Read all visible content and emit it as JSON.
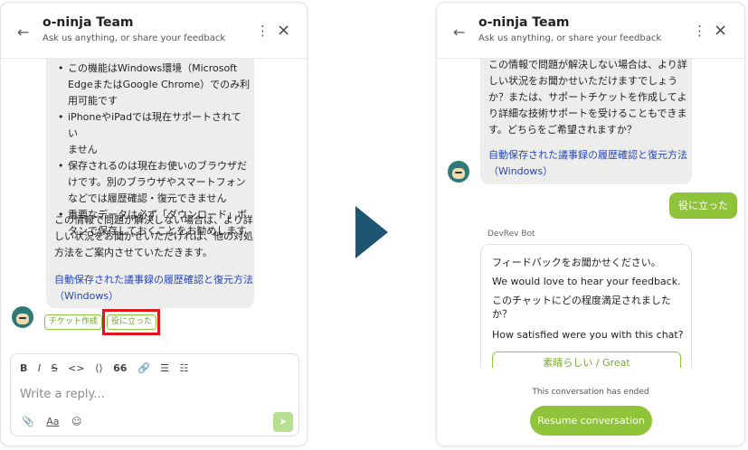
{
  "left_panel": {
    "header": {
      "title": "o-ninja Team",
      "subtitle": "Ask us anything, or share your feedback",
      "back_icon": "←",
      "menu_icon": "⋮",
      "close_icon": "×"
    },
    "message": {
      "bullets": [
        "この機能はWindows環境（Microsoft",
        "EdgeまたはGoogle Chrome）でのみ利",
        "用可能です",
        "iPhoneやiPadでは現在サポートされてい",
        "ません",
        "保存されるのは現在お使いのブラウザだ",
        "けです。別のブラウザやスマートフォン",
        "などでは履歴確認・復元できません",
        "重要なデータは必ず「ダウンロード」ボ",
        "タンで保存しておくことをお勧めします"
      ],
      "paragraph": [
        "この情報で問題が解決しない場合は、より詳",
        "しい状況をお聞かせいただければ、他の対処",
        "方法をご案内させていただきます。"
      ],
      "link": [
        "自動保存された議事録の履歴確認と復元方法",
        "（Windows）"
      ]
    },
    "quick_replies": {
      "ticket": "チケット作成",
      "helped": "役に立った"
    },
    "composer": {
      "toolbar": {
        "bold": "B",
        "italic": "I",
        "strike": "S",
        "code": "<>",
        "code_block": "⟨⟩",
        "quote": "66",
        "link": "🔗",
        "bullet_list": "☰",
        "numbered_list": "☷"
      },
      "placeholder": "Write a reply...",
      "attach": "📎",
      "format": "Aa",
      "emoji": "☺",
      "send": "➤"
    }
  },
  "right_panel": {
    "header": {
      "title": "o-ninja Team",
      "subtitle": "Ask us anything, or share your feedback",
      "back_icon": "←",
      "menu_icon": "⋮",
      "close_icon": "×"
    },
    "message": {
      "paragraph": [
        "この情報で問題が解決しない場合は、より詳",
        "しい状況をお聞かせいただけますでしょう",
        "か？または、サポートチケットを作成してよ",
        "り詳細な技術サポートを受けることもできま",
        "す。どちらをご希望されますか？"
      ],
      "link": [
        "自動保存された議事録の履歴確認と復元方法",
        "（Windows）"
      ]
    },
    "user_reply": "役に立った",
    "bot_name": "DevRev Bot",
    "card": {
      "line1": "フィードバックをお聞かせください。",
      "line2": "We would love to hear your feedback.",
      "line3a": "このチャットにどの程度満足されました",
      "line3b": "か？",
      "line4": "How satisfied were you with this chat?",
      "rating": "素晴らしい / Great"
    },
    "footer": {
      "ended": "This conversation has ended",
      "resume": "Resume conversation"
    }
  },
  "colors": {
    "accent_green": "#8fc43a",
    "link_blue": "#2746b5",
    "highlight_red": "#e3151a",
    "arrow_blue": "#1e5573"
  }
}
